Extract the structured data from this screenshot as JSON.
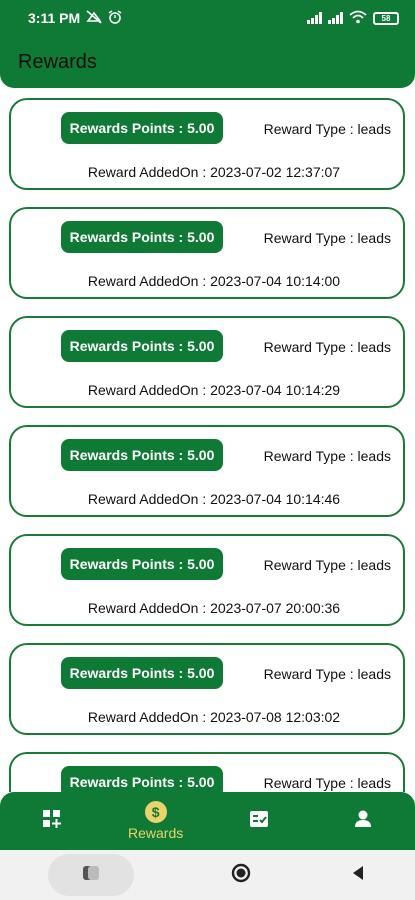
{
  "status_bar": {
    "time": "3:11 PM",
    "battery": "58",
    "icons": [
      "no-disturb-icon",
      "alarm-icon",
      "signal-icon",
      "signal-icon",
      "wifi-icon",
      "battery-icon"
    ]
  },
  "app_bar": {
    "title": "Rewards"
  },
  "rewards": [
    {
      "points": "Rewards Points : 5.00",
      "type": "Reward Type : leads",
      "added": "Reward AddedOn : 2023-07-02 12:37:07"
    },
    {
      "points": "Rewards Points : 5.00",
      "type": "Reward Type : leads",
      "added": "Reward AddedOn : 2023-07-04 10:14:00"
    },
    {
      "points": "Rewards Points : 5.00",
      "type": "Reward Type : leads",
      "added": "Reward AddedOn : 2023-07-04 10:14:29"
    },
    {
      "points": "Rewards Points : 5.00",
      "type": "Reward Type : leads",
      "added": "Reward AddedOn : 2023-07-04 10:14:46"
    },
    {
      "points": "Rewards Points : 5.00",
      "type": "Reward Type : leads",
      "added": "Reward AddedOn : 2023-07-07 20:00:36"
    },
    {
      "points": "Rewards Points : 5.00",
      "type": "Reward Type : leads",
      "added": "Reward AddedOn : 2023-07-08 12:03:02"
    },
    {
      "points": "Rewards Points : 5.00",
      "type": "Reward Type : leads",
      "added": ""
    }
  ],
  "bottom_nav": {
    "items": [
      {
        "icon": "dashboard-add-icon",
        "label": ""
      },
      {
        "icon": "dollar-coin-icon",
        "label": "Rewards",
        "active": true
      },
      {
        "icon": "checklist-icon",
        "label": ""
      },
      {
        "icon": "profile-icon",
        "label": ""
      }
    ]
  },
  "colors": {
    "primary": "#0f7a35",
    "accent": "#e9d36a",
    "card_border": "#1c7a38"
  }
}
